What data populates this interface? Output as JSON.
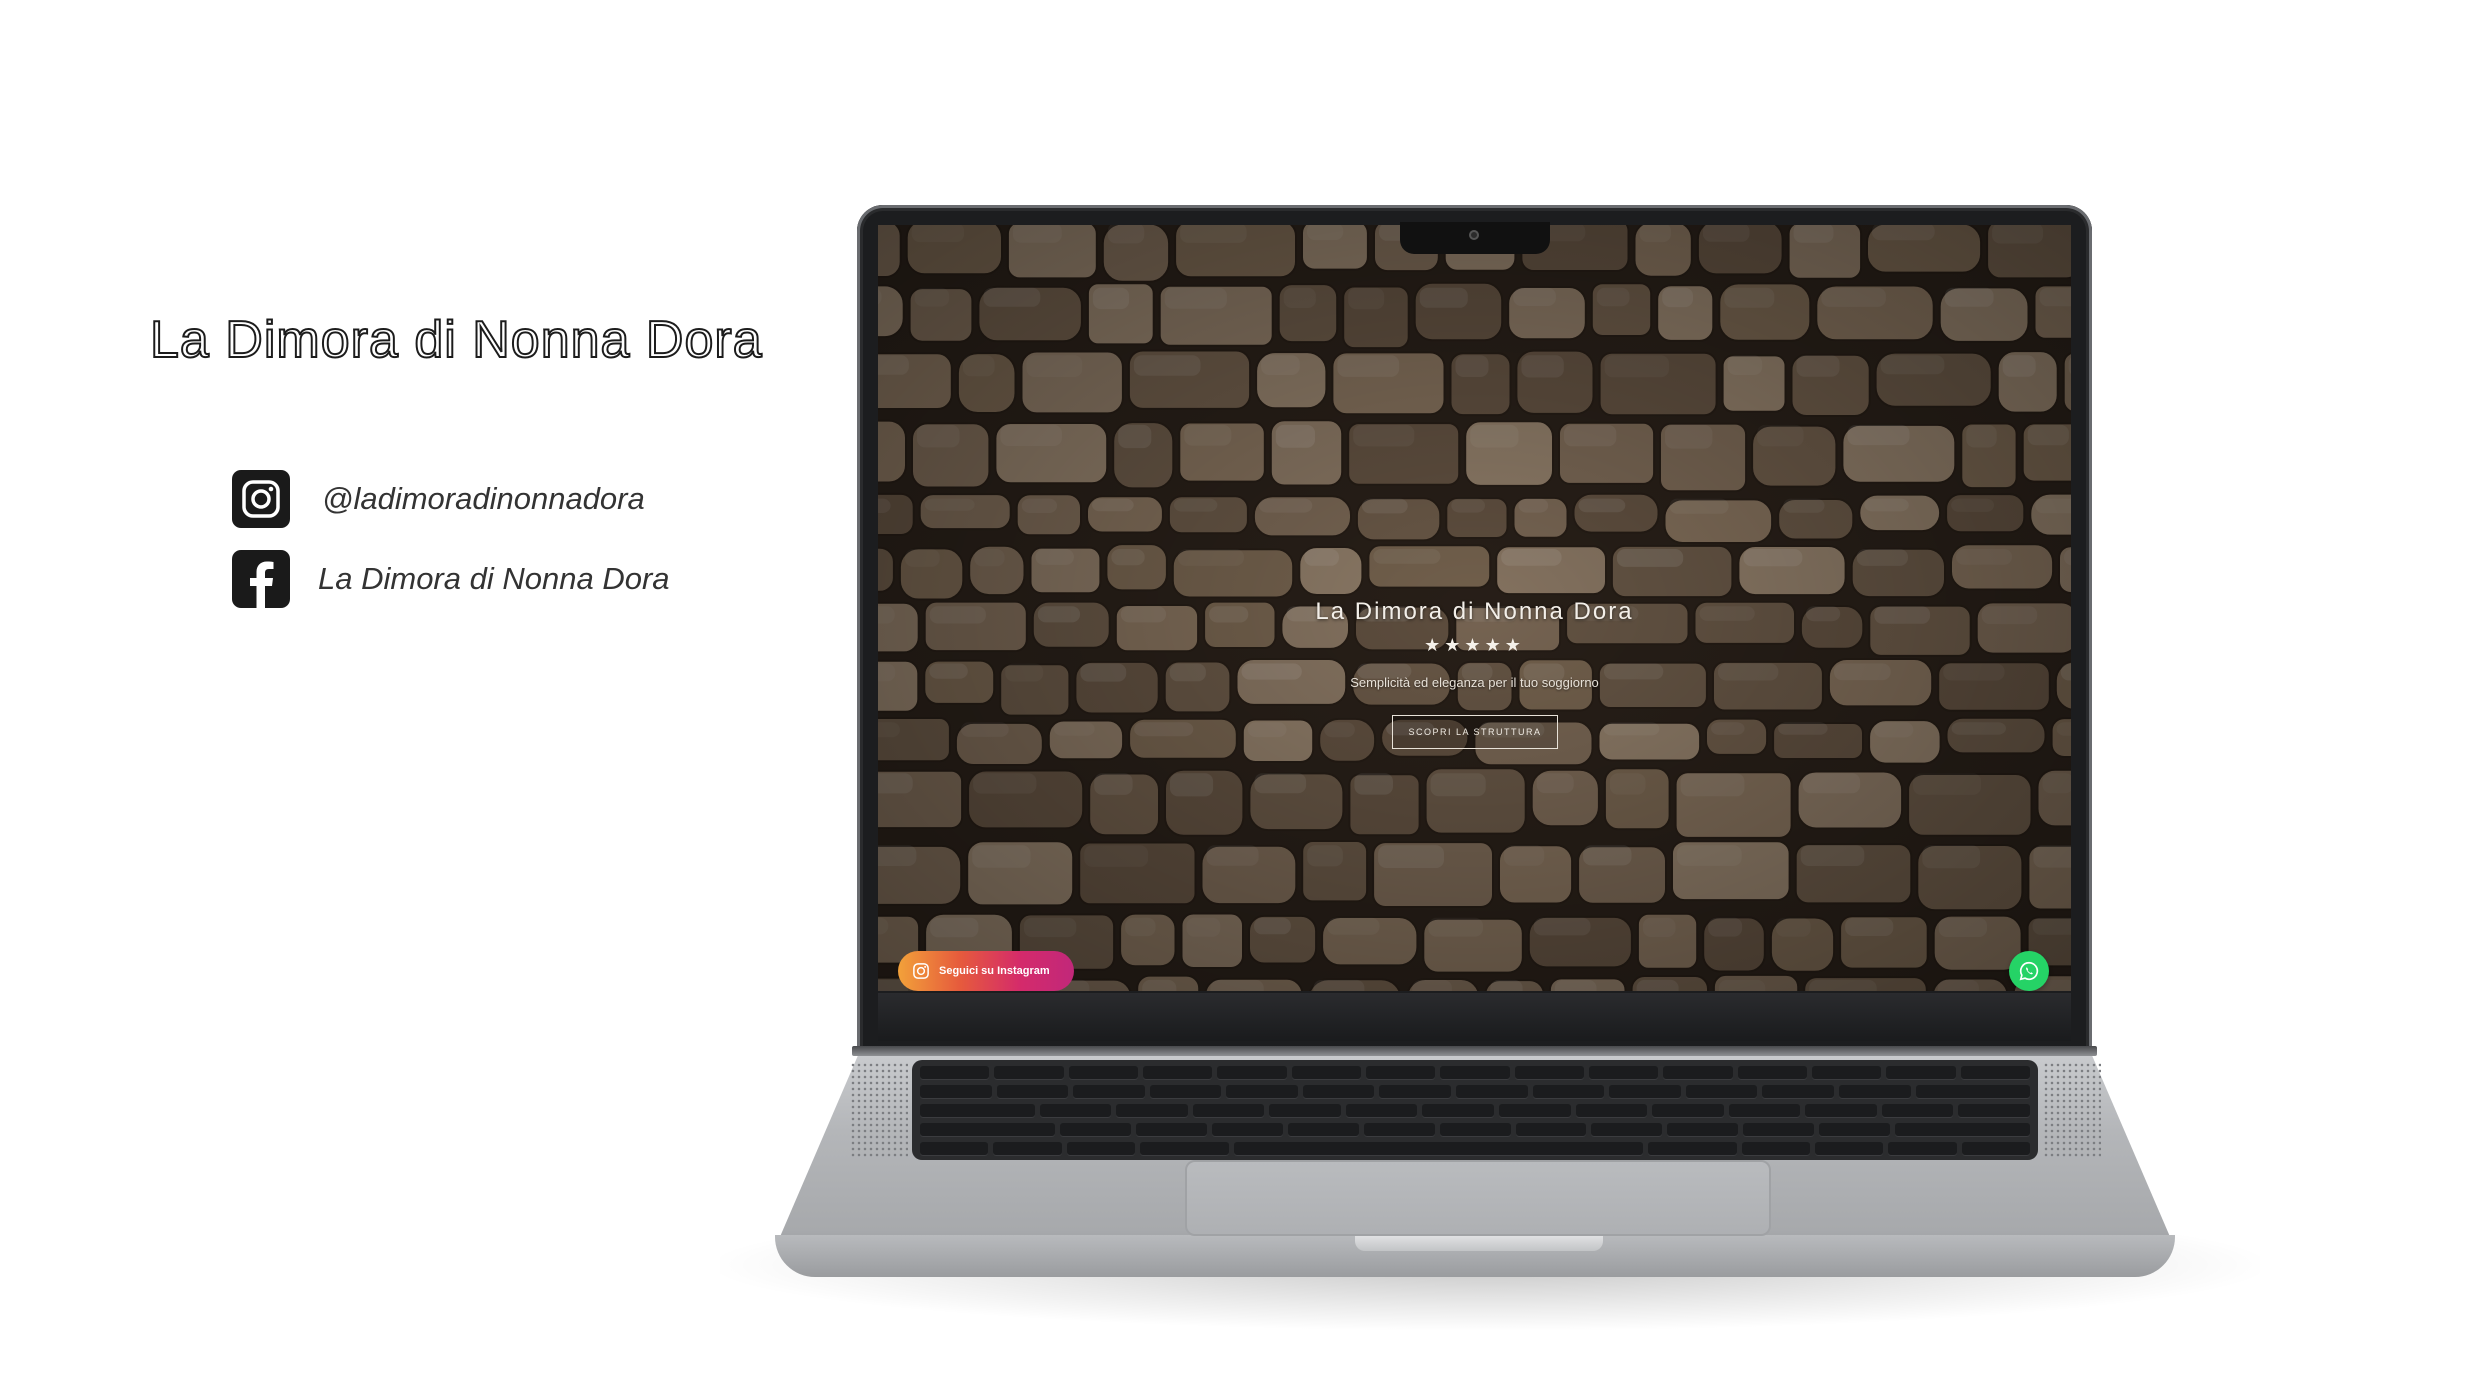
{
  "brand": {
    "title": "La Dimora di Nonna Dora"
  },
  "socials": {
    "instagram": {
      "icon": "instagram-icon",
      "handle": "@ladimoradinonnadora"
    },
    "facebook": {
      "icon": "facebook-icon",
      "name": "La Dimora di Nonna Dora"
    }
  },
  "website": {
    "title": "La Dimora di Nonna Dora",
    "stars": "★★★★★",
    "rating_stars": 5,
    "subtitle": "Semplicità ed eleganza per il tuo soggiorno",
    "cta_label": "SCOPRI LA STRUTTURA",
    "instagram_button": {
      "icon": "instagram-icon",
      "label": "Seguici su Instagram"
    },
    "whatsapp_button": {
      "icon": "whatsapp-icon"
    }
  },
  "colors": {
    "whatsapp": "#25d366",
    "instagram_gradient_start": "#f2a13a",
    "instagram_gradient_end": "#c1287a"
  }
}
